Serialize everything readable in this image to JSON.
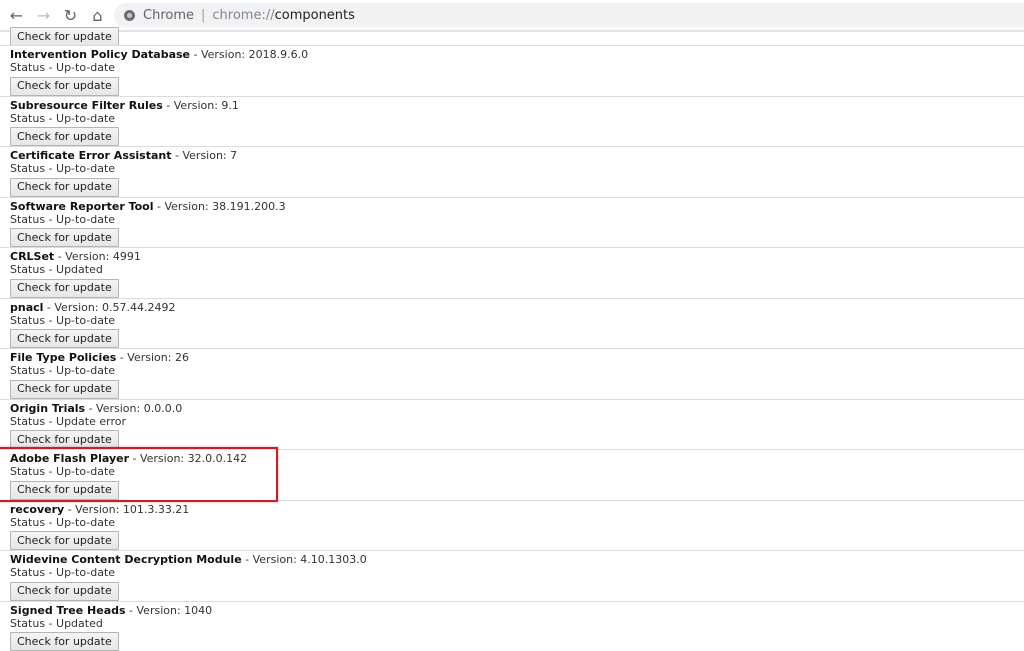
{
  "browser": {
    "back_icon": "←",
    "forward_icon": "→",
    "reload_icon": "↻",
    "home_icon": "⌂",
    "origin_label": "Chrome",
    "separator": "|",
    "url_scheme": "chrome://",
    "url_host": "components"
  },
  "button_label": "Check for update",
  "version_prefix": " - Version: ",
  "status_prefix": "Status - ",
  "highlight_color": "#c8202a",
  "components": [
    {
      "name": "Intervention Policy Database",
      "version": "2018.9.6.0",
      "status": "Up-to-date"
    },
    {
      "name": "Subresource Filter Rules",
      "version": "9.1",
      "status": "Up-to-date"
    },
    {
      "name": "Certificate Error Assistant",
      "version": "7",
      "status": "Up-to-date"
    },
    {
      "name": "Software Reporter Tool",
      "version": "38.191.200.3",
      "status": "Up-to-date"
    },
    {
      "name": "CRLSet",
      "version": "4991",
      "status": "Updated"
    },
    {
      "name": "pnacl",
      "version": "0.57.44.2492",
      "status": "Up-to-date"
    },
    {
      "name": "File Type Policies",
      "version": "26",
      "status": "Up-to-date"
    },
    {
      "name": "Origin Trials",
      "version": "0.0.0.0",
      "status": "Update error"
    },
    {
      "name": "Adobe Flash Player",
      "version": "32.0.0.142",
      "status": "Up-to-date",
      "highlighted": true
    },
    {
      "name": "recovery",
      "version": "101.3.33.21",
      "status": "Up-to-date"
    },
    {
      "name": "Widevine Content Decryption Module",
      "version": "4.10.1303.0",
      "status": "Up-to-date"
    },
    {
      "name": "Signed Tree Heads",
      "version": "1040",
      "status": "Updated"
    }
  ]
}
